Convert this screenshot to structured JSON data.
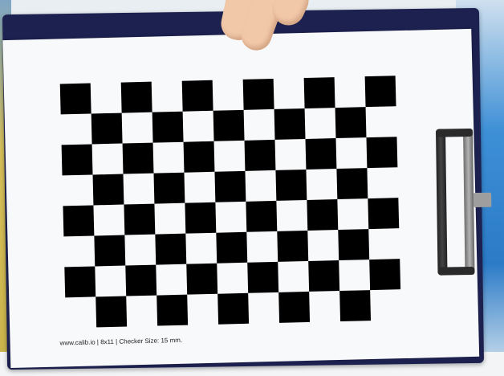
{
  "photo": {
    "subject": "chessboard-calibration-target",
    "paper_text": "www.calib.io | 8x11 | Checker Size: 15 mm.",
    "pattern": {
      "rows": 8,
      "cols": 11
    },
    "colors": {
      "clipboard": "#1d2150",
      "paper": "#f8f9fb",
      "checker": "#000000",
      "skin": "#f1c9a9"
    }
  }
}
